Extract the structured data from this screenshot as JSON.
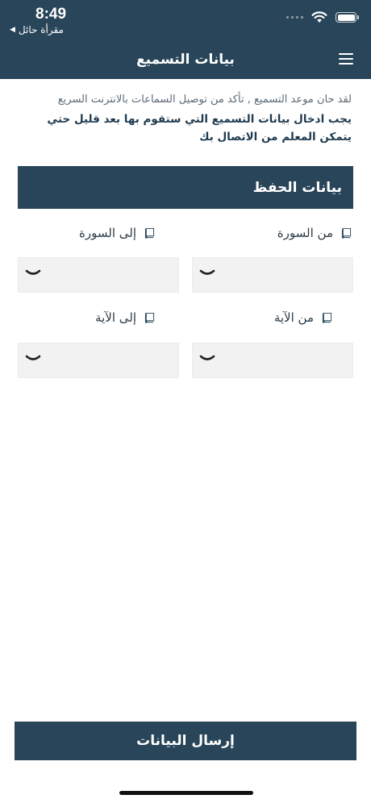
{
  "status_bar": {
    "time": "8:49",
    "back_app": "مقرأة حائل"
  },
  "nav": {
    "title": "بيانات التسميع"
  },
  "intro": {
    "notice": "لقد حان موعد التسميع , تأكد من توصيل السماعات بالانترنت السريع",
    "instruction": "يجب ادخال بيانات التسميع التي ستقوم بها بعد قليل حتي يتمكن المعلم من الاتصال بك"
  },
  "section": {
    "title": "بيانات الحفظ"
  },
  "fields": {
    "from_surah": {
      "label": "من السورة",
      "value": ""
    },
    "to_surah": {
      "label": "إلى السورة",
      "value": ""
    },
    "from_ayah": {
      "label": "من الآية",
      "value": ""
    },
    "to_ayah": {
      "label": "إلى الآية",
      "value": ""
    }
  },
  "submit": {
    "label": "إرسال البيانات"
  },
  "colors": {
    "primary": "#284559",
    "field_bg": "#f2f2f2"
  }
}
